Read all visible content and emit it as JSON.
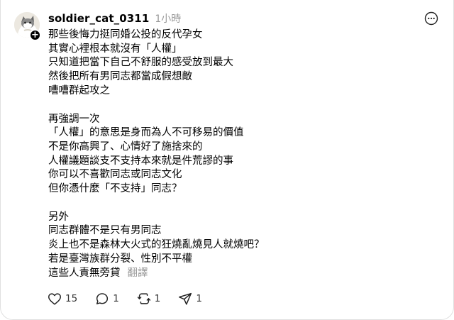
{
  "post": {
    "username": "soldier_cat_0311",
    "time": "1小時",
    "paragraphs": [
      {
        "lines": [
          "那些後悔力挺同婚公投的反代孕女",
          "其實心裡根本就沒有「人權」",
          "只知道把當下自己不舒服的感受放到最大",
          "然後把所有男同志都當成假想敵",
          "嘈嘈群起攻之"
        ]
      },
      {
        "lines": [
          "再強調一次",
          "「人權」的意思是身而為人不可移易的價值",
          "不是你高興了、心情好了施捨來的",
          "人權議題談支不支持本來就是件荒謬的事",
          "你可以不喜歡同志或同志文化",
          "但你憑什麼「不支持」同志？"
        ]
      },
      {
        "lines": [
          "另外",
          "同志群體不是只有男同志",
          "炎上也不是森林大火式的狂燒亂燒見人就燒吧？",
          "若是臺灣族群分裂、性別不平權",
          "這些人責無旁貸"
        ]
      }
    ],
    "translate_label": "翻譯"
  },
  "actions": {
    "like_count": "15",
    "reply_count": "1",
    "repost_count": "1",
    "share_count": "1"
  },
  "icons": {
    "avatar": "cat-avatar",
    "follow": "plus-icon",
    "more": "more-icon",
    "like": "heart-icon",
    "reply": "comment-icon",
    "repost": "repost-icon",
    "share": "send-icon"
  }
}
